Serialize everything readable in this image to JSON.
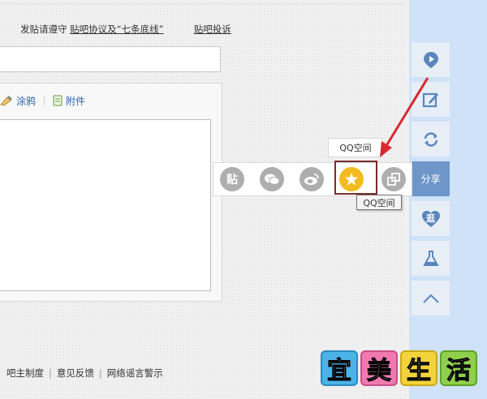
{
  "post_form": {
    "rules_prefix": "发贴请遵守",
    "rules_link": "贴吧协议及“七条底线”",
    "report_link": "贴吧投诉",
    "toolbar": [
      {
        "label": "涂鸦",
        "icon": "doodle-icon"
      },
      {
        "label": "附件",
        "icon": "attachment-icon"
      }
    ]
  },
  "share_popup": {
    "title_tooltip": "QQ空间",
    "hover_tooltip": "QQ空间",
    "tieba_label": "贴",
    "items": [
      {
        "name": "tieba",
        "icon": "tieba-icon"
      },
      {
        "name": "wechat",
        "icon": "wechat-icon"
      },
      {
        "name": "weibo",
        "icon": "weibo-icon"
      },
      {
        "name": "qzone",
        "icon": "qzone-star-icon"
      },
      {
        "name": "copy-link",
        "icon": "copy-link-icon"
      }
    ]
  },
  "right_rail": {
    "share_label": "分享",
    "guang_label": "逛",
    "items": [
      {
        "name": "play",
        "icon": "play-icon"
      },
      {
        "name": "edit",
        "icon": "edit-icon"
      },
      {
        "name": "refresh",
        "icon": "refresh-icon"
      },
      {
        "name": "share",
        "icon": ""
      },
      {
        "name": "guang",
        "icon": "heart-icon"
      },
      {
        "name": "lab",
        "icon": "flask-icon"
      },
      {
        "name": "back-to-top",
        "icon": "chevron-up-icon"
      }
    ]
  },
  "footer": {
    "links": [
      "吧主制度",
      "意见反馈",
      "网络谣言警示"
    ],
    "separator": "|"
  },
  "watermark": {
    "chars": [
      "宜",
      "美",
      "生",
      "活"
    ]
  },
  "colors": {
    "rail_background": "#cfe2f7",
    "rail_active": "#6e96c9",
    "qzone_gold": "#f2bb1f",
    "annotation_red": "#d9282f",
    "link_blue": "#2d64b3"
  }
}
